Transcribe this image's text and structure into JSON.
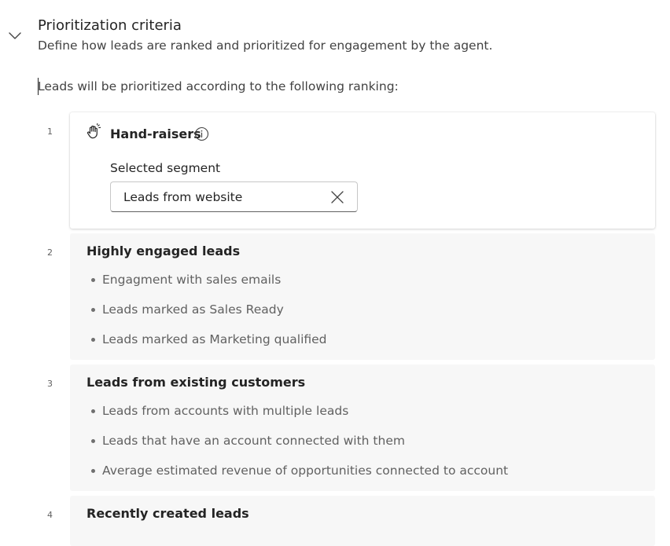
{
  "section": {
    "title": "Prioritization criteria",
    "description": "Define how leads are ranked and prioritized for engagement by the agent.",
    "toggle_icon": "chevron-down-icon"
  },
  "ranking_intro": "Leads will be prioritized according to the following ranking:",
  "criteria": [
    {
      "rank": "1",
      "icon": "hand-raise-icon",
      "title": "Hand-raisers",
      "segment_label": "Selected segment",
      "segment_value": "Leads from website"
    },
    {
      "rank": "2",
      "title": "Highly engaged leads",
      "bullets": [
        "Engagment with sales emails",
        "Leads marked as Sales Ready",
        "Leads marked as Marketing qualified"
      ]
    },
    {
      "rank": "3",
      "title": "Leads from existing customers",
      "bullets": [
        "Leads from accounts with multiple leads",
        "Leads that have an account connected with them",
        "Average estimated revenue of opportunities connected to account"
      ]
    },
    {
      "rank": "4",
      "title": "Recently created leads"
    }
  ]
}
